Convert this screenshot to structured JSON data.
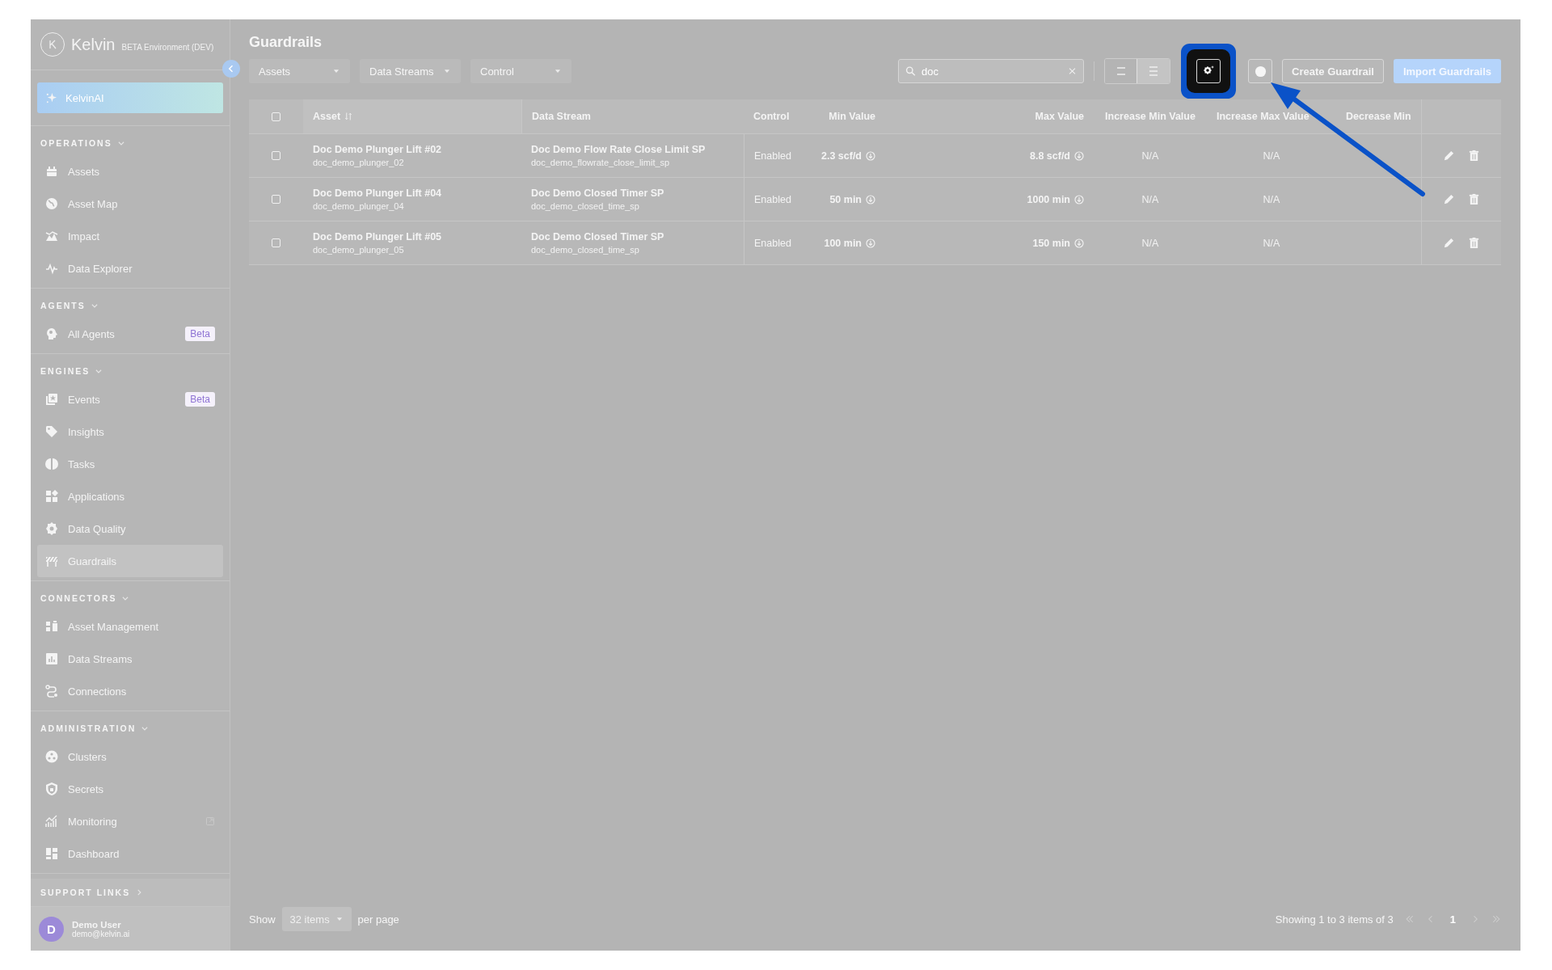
{
  "sidebar": {
    "logo": "Kelvin",
    "environment": "BETA Environment (DEV)",
    "ai_button": "KelvinAI",
    "sections": [
      {
        "title": "OPERATIONS",
        "expanded": true,
        "items": [
          {
            "label": "Assets",
            "selected": false
          },
          {
            "label": "Asset Map",
            "selected": false
          },
          {
            "label": "Impact",
            "selected": false
          },
          {
            "label": "Data Explorer",
            "selected": false
          }
        ]
      },
      {
        "title": "AGENTS",
        "expanded": true,
        "items": [
          {
            "label": "All Agents",
            "badge": "Beta",
            "selected": false
          }
        ]
      },
      {
        "title": "ENGINES",
        "expanded": true,
        "items": [
          {
            "label": "Events",
            "badge": "Beta",
            "selected": false
          },
          {
            "label": "Insights",
            "selected": false
          },
          {
            "label": "Tasks",
            "selected": false
          },
          {
            "label": "Applications",
            "selected": false
          },
          {
            "label": "Data Quality",
            "selected": false
          },
          {
            "label": "Guardrails",
            "selected": true
          }
        ]
      },
      {
        "title": "CONNECTORS",
        "expanded": true,
        "items": [
          {
            "label": "Asset Management",
            "selected": false
          },
          {
            "label": "Data Streams",
            "selected": false
          },
          {
            "label": "Connections",
            "selected": false
          }
        ]
      },
      {
        "title": "ADMINISTRATION",
        "expanded": true,
        "items": [
          {
            "label": "Clusters",
            "selected": false
          },
          {
            "label": "Secrets",
            "selected": false
          },
          {
            "label": "Monitoring",
            "external": true,
            "selected": false
          },
          {
            "label": "Dashboard",
            "selected": false
          }
        ]
      }
    ],
    "support_links": {
      "title": "SUPPORT LINKS",
      "expanded": false
    },
    "user": {
      "initial": "D",
      "name": "Demo User",
      "email": "demo@kelvin.ai"
    }
  },
  "main": {
    "title": "Guardrails",
    "filters": [
      {
        "label": "Assets"
      },
      {
        "label": "Data Streams"
      },
      {
        "label": "Control"
      }
    ],
    "search": {
      "value": "doc"
    },
    "view_modes": [
      {
        "selected": false
      },
      {
        "selected": true
      }
    ],
    "settings_button": {
      "highlighted": true
    },
    "buttons": [
      {
        "label": "Create Guardrail",
        "kind": "outline"
      },
      {
        "label": "Import Guardrails",
        "kind": "primary"
      }
    ],
    "table": {
      "header_checkbox": {
        "checked": false
      },
      "columns": [
        "Asset",
        "Data Stream",
        "Control",
        "Min Value",
        "Max Value",
        "Increase Min Value",
        "Increase Max Value",
        "Decrease Min"
      ],
      "rows": [
        {
          "asset": "Doc Demo Plunger Lift #02",
          "asset_id": "doc_demo_plunger_02",
          "data_stream": "Doc Demo Flow Rate Close Limit SP",
          "data_stream_id": "doc_demo_flowrate_close_limit_sp",
          "control": "Enabled",
          "min_value": "2.3 scf/d",
          "max_value": "8.8 scf/d",
          "increase_min": "N/A",
          "increase_max": "N/A",
          "selected": false
        },
        {
          "asset": "Doc Demo Plunger Lift #04",
          "asset_id": "doc_demo_plunger_04",
          "data_stream": "Doc Demo Closed Timer SP",
          "data_stream_id": "doc_demo_closed_time_sp",
          "control": "Enabled",
          "min_value": "50 min",
          "max_value": "1000 min",
          "increase_min": "N/A",
          "increase_max": "N/A",
          "selected": false
        },
        {
          "asset": "Doc Demo Plunger Lift #05",
          "asset_id": "doc_demo_plunger_05",
          "data_stream": "Doc Demo Closed Timer SP",
          "data_stream_id": "doc_demo_closed_time_sp",
          "control": "Enabled",
          "min_value": "100 min",
          "max_value": "150 min",
          "increase_min": "N/A",
          "increase_max": "N/A",
          "selected": false
        }
      ]
    },
    "footer": {
      "show": "Show",
      "page_size": "32 items",
      "per_page": "per page",
      "summary": "Showing 1 to 3 items of 3",
      "current_page": "1"
    }
  },
  "annotations": [
    {
      "kind": "arrow"
    }
  ]
}
